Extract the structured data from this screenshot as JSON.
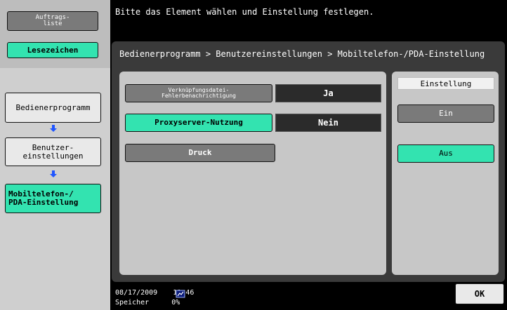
{
  "sidebar": {
    "auftrags_label": "Auftrags-\nliste",
    "lesezeichen_label": "Lesezeichen",
    "crumb_1": "Bedienerprogramm",
    "crumb_2": "Benutzer-\neinstellungen",
    "crumb_3": "Mobiltelefon-/\nPDA-Einstellung"
  },
  "header": {
    "message": "Bitte das Element wählen und Einstellung festlegen."
  },
  "content": {
    "path": "Bedienerprogramm > Benutzereinstellungen > Mobiltelefon-/PDA-Einstellung",
    "rows": [
      {
        "label": "Verknüpfungsdatei-\nFehlerbenachrichtigung",
        "value": "Ja"
      },
      {
        "label": "Proxyserver-Nutzung",
        "value": "Nein"
      },
      {
        "label": "Druck",
        "value": ""
      }
    ],
    "settings": {
      "header": "Einstellung",
      "option_on": "Ein",
      "option_off": "Aus"
    }
  },
  "footer": {
    "date": "08/17/2009",
    "time": "11:46",
    "memory_label": "Speicher",
    "memory_value": "0%",
    "ok_label": "OK"
  },
  "colors": {
    "accent_green": "#33e3b0",
    "arrow_blue": "#1f55ff"
  },
  "icons": {
    "network": "network-status-icon"
  }
}
